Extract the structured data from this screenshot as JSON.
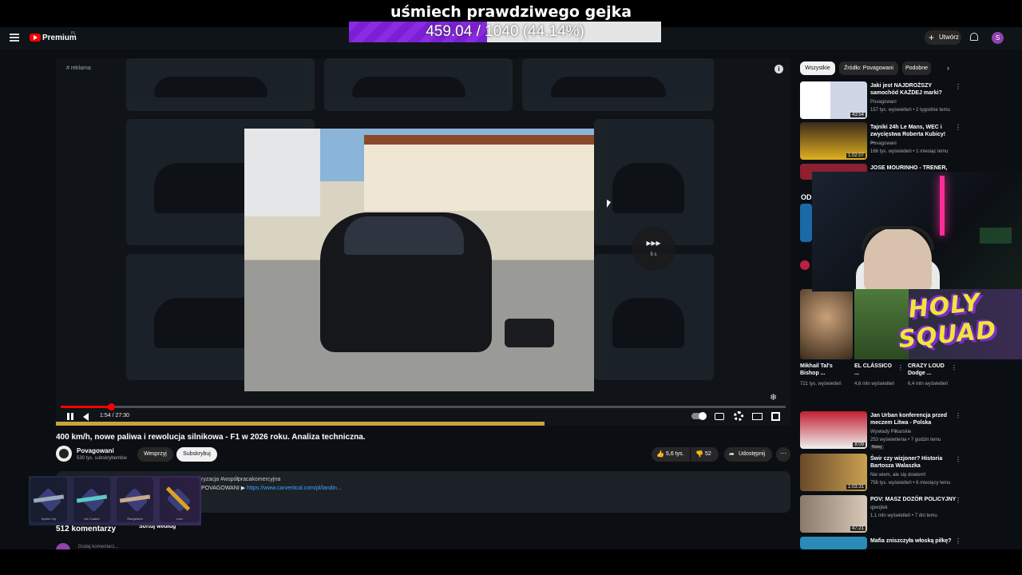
{
  "stream_overlay": {
    "goal_title": "uśmiech prawdziwego gejka",
    "goal_current": "459.04",
    "goal_separator": " / ",
    "goal_target": "1040 (44.14%)",
    "goal_fraction": 0.4414,
    "goal_bar_color": "#8a2be2"
  },
  "youtube": {
    "logo_text": "Premium",
    "region": "PL",
    "create_label": "Utwórz",
    "avatar_letter": "S",
    "menu_icon": "hamburger-menu-icon",
    "bell_icon": "bell-icon"
  },
  "player": {
    "ad_label": "# reklama",
    "info_icon": "i",
    "skip_arrows": "▸▸▸",
    "skip_countdown": "5 s",
    "time": "1:54 / 27:30",
    "progress_fraction": 0.069,
    "accent_color": "#ff0000",
    "ad_bar_color": "#caa43a",
    "controls": [
      "pause-icon",
      "volume-icon",
      "autoplay-toggle",
      "subtitles-icon",
      "settings-gear-icon",
      "theater-icon",
      "fullscreen-icon"
    ]
  },
  "video": {
    "title": "400 km/h, nowe paliwa i rewolucja silnikowa - F1 w 2026 roku. Analiza techniczna.",
    "channel": "Povagowani",
    "subscribers": "530 tys. subskrybentów",
    "support_label": "Wesprzyj",
    "subscribe_label": "Subskrybuj",
    "likes": "5,6 tys.",
    "dislikes": "52",
    "share_label": "Udostępnij",
    "more_label": "···"
  },
  "description": {
    "line1": "ryzacja #współpracakomercyjna",
    "line2_prefix": "PO​VAGOWANI ▶ ",
    "line2_link": "https://www.carvertical.com/pl/landin..."
  },
  "comments": {
    "count": "512 komentarzy",
    "sort_label": "Sortuj według",
    "placeholder": "Dodaj komentarz..."
  },
  "skins": [
    {
      "name": "Spider Lily"
    },
    {
      "name": "Ice Coaled"
    },
    {
      "name": "Rangeland"
    },
    {
      "name": "Lore"
    }
  ],
  "sidebar": {
    "chips": [
      "Wszystkie",
      "Źródło: Povagowani",
      "Podobne"
    ],
    "videos": [
      {
        "title": "Jaki jest NAJDROŻSZY samochód KAŻDEJ marki?",
        "channel": "Povagowani",
        "meta": "157 tys. wyświetleń • 2 tygodnie temu",
        "duration": "43:54"
      },
      {
        "title": "Tajniki 24h Le Mans, WEC i zwycięstwa Roberta Kubicy! ...",
        "channel": "Povagowani",
        "meta": "166 tys. wyświetleń • 1 miesiąc temu",
        "duration": "1:02:07"
      },
      {
        "title": "JOSE MOURINHO - TRENER,",
        "channel": "",
        "meta": "",
        "duration": ""
      }
    ],
    "shorts": [
      {
        "title": "Mikhail Tal's Bishop ...",
        "meta": "721 tys. wyświetleń"
      },
      {
        "title": "EL CLÁSSICO ...",
        "meta": "4,6 mln wyświetleń"
      },
      {
        "title": "CRAZY LOUD Dodge ...",
        "meta": "6,4 mln wyświetleń"
      }
    ],
    "videos2": [
      {
        "title": "Jan Urban konferencja przed meczem Litwa - Polska",
        "channel": "Wywiady Piłkarskie",
        "meta": "253 wyświetlenia • 7 godzin temu",
        "badge": "Nowy",
        "duration": "8:09"
      },
      {
        "title": "Świr czy wizjoner? Historia Bartosza Walaszka",
        "channel": "Nie wiem, ale się dowiem!",
        "meta": "756 tys. wyświetleń • 6 miesięcy temu",
        "duration": "1:03:31"
      },
      {
        "title": "POV: MASZ DOZÓR POLICYJNY",
        "channel": "qjwojtek",
        "meta": "1,1 mln wyświetleń • 7 dni temu",
        "duration": "47:21"
      },
      {
        "title": "Mafia zniszczyła włoską piłkę?",
        "channel": "",
        "meta": "",
        "duration": ""
      }
    ]
  },
  "webcam": {
    "partial_text": "OD"
  },
  "holy_squad": {
    "text": "HOLY SQUAD"
  }
}
